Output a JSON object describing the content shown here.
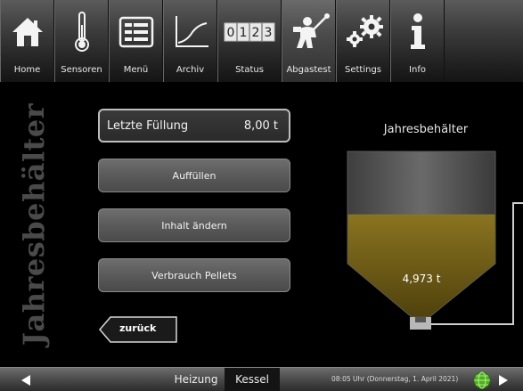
{
  "toolbar": {
    "items": [
      {
        "label": "Home",
        "icon": "home-icon"
      },
      {
        "label": "Sensoren",
        "icon": "thermometer-icon"
      },
      {
        "label": "Menü",
        "icon": "menu-list-icon"
      },
      {
        "label": "Archiv",
        "icon": "chart-line-icon"
      },
      {
        "label": "Status",
        "icon": "counter-icon",
        "counter": [
          "0",
          "1",
          "2",
          "3"
        ]
      },
      {
        "label": "Abgastest",
        "icon": "chimney-sweep-icon"
      },
      {
        "label": "Settings",
        "icon": "gears-icon"
      },
      {
        "label": "Info",
        "icon": "info-icon"
      }
    ],
    "active_index": 5
  },
  "side_title": "Jahresbehälter",
  "last_fill": {
    "label": "Letzte Füllung",
    "value": "8,00 t"
  },
  "buttons": {
    "fill": "Auffüllen",
    "change_content": "Inhalt ändern",
    "consumption": "Verbrauch Pellets",
    "back": "zurück"
  },
  "container": {
    "title": "Jahresbehälter",
    "level_text": "4,973 t",
    "fill_fraction": 0.62
  },
  "bottom": {
    "tab_heizung": "Heizung",
    "tab_kessel": "Kessel",
    "datetime": "08:05 Uhr (Donnerstag, 1. April 2021)"
  },
  "colors": {
    "pellet_fill": "#7a6414",
    "toolbar": "#3e3e3e",
    "globe": "#4caf23"
  }
}
